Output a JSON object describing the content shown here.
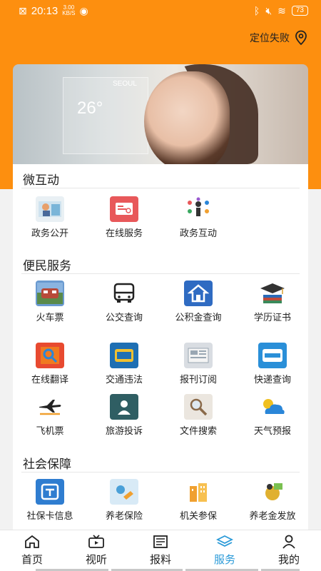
{
  "status": {
    "time": "20:13",
    "speed_top": "3.00",
    "speed_bottom": "KB/S",
    "battery": "73"
  },
  "location": {
    "label": "定位失败"
  },
  "banner": {
    "city": "SEOUL",
    "temp": "26°"
  },
  "sections": {
    "micro": {
      "title": "微互动",
      "items": [
        {
          "label": "政务公开",
          "icon": "government-open-icon",
          "color": "#7ab5d8"
        },
        {
          "label": "在线服务",
          "icon": "online-service-icon",
          "color": "#e8585a"
        },
        {
          "label": "政务互动",
          "icon": "government-interaction-icon",
          "color": "#f0a030"
        }
      ]
    },
    "convenience": {
      "title": "便民服务",
      "items": [
        {
          "label": "火车票",
          "icon": "train-ticket-icon",
          "color": "#b84a3a"
        },
        {
          "label": "公交查询",
          "icon": "bus-query-icon",
          "color": "#333333"
        },
        {
          "label": "公积金查询",
          "icon": "housing-fund-icon",
          "color": "#2f6bc2"
        },
        {
          "label": "学历证书",
          "icon": "education-certificate-icon",
          "color": "#5a4a80"
        },
        {
          "label": "在线翻译",
          "icon": "online-translate-icon",
          "color": "#e84a30"
        },
        {
          "label": "交通违法",
          "icon": "traffic-violation-icon",
          "color": "#1e6fb3"
        },
        {
          "label": "报刊订阅",
          "icon": "newspaper-subscribe-icon",
          "color": "#9aa7b3"
        },
        {
          "label": "快递查询",
          "icon": "express-query-icon",
          "color": "#2a8fd8"
        },
        {
          "label": "飞机票",
          "icon": "flight-ticket-icon",
          "color": "#222222"
        },
        {
          "label": "旅游投诉",
          "icon": "travel-complaint-icon",
          "color": "#2f5e63"
        },
        {
          "label": "文件搜索",
          "icon": "file-search-icon",
          "color": "#b9b2a8"
        },
        {
          "label": "天气预报",
          "icon": "weather-forecast-icon",
          "color": "#2a86d8"
        }
      ]
    },
    "social": {
      "title": "社会保障",
      "items": [
        {
          "label": "社保卡信息",
          "icon": "social-security-card-icon",
          "color": "#2f7dd0"
        },
        {
          "label": "养老保险",
          "icon": "pension-insurance-icon",
          "color": "#4aa0d8"
        },
        {
          "label": "机关参保",
          "icon": "institution-insurance-icon",
          "color": "#f0a030"
        },
        {
          "label": "养老金发放",
          "icon": "pension-payment-icon",
          "color": "#d8a030"
        }
      ]
    }
  },
  "tabs": [
    {
      "label": "首页",
      "icon": "home-icon",
      "active": false
    },
    {
      "label": "视听",
      "icon": "video-icon",
      "active": false
    },
    {
      "label": "报料",
      "icon": "report-icon",
      "active": false
    },
    {
      "label": "服务",
      "icon": "service-layers-icon",
      "active": true
    },
    {
      "label": "我的",
      "icon": "user-icon",
      "active": false
    }
  ]
}
